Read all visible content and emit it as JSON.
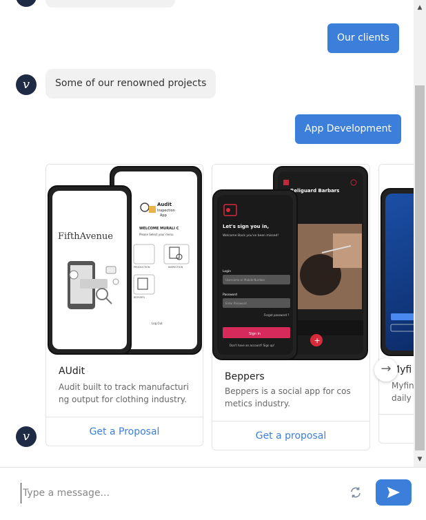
{
  "messages": {
    "our_clients": "Our clients",
    "renowned": "Some of our renowned projects",
    "app_development": "App Development"
  },
  "avatar_letter": "v",
  "cards": [
    {
      "title": "AUdit",
      "desc": "Audit built to track manufacturing output for clothing industry.",
      "button": "Get a Proposal",
      "mock": {
        "brand": "FifthAvenue",
        "app_title": "Audit Inspection App",
        "welcome": "WELCOME MURALI C",
        "select": "Please Select your menu",
        "items": [
          "PRODUCTION",
          "INSPECTION",
          "REPORTS"
        ],
        "logout": "Log Out"
      }
    },
    {
      "title": "Beppers",
      "desc": "Beppers is a social app for cosmetics industry.",
      "button": "Get a proposal",
      "mock": {
        "signin_title": "Let's sign you in,",
        "welcome": "Welcome Back you've been missed!",
        "login_label": "Login",
        "login_ph": "Username or Mobile Number",
        "password_label": "Password",
        "password_ph": "Enter Password",
        "forgot": "Forgot password ?",
        "signin_btn": "Sign in",
        "signup": "Don't have an account? Sign up!",
        "shop": "Religuard Barbars"
      }
    },
    {
      "title": "Myfi",
      "desc": "Myfin daily"
    }
  ],
  "composer": {
    "placeholder": "Type a message..."
  },
  "colors": {
    "accent": "#3b7fdb",
    "avatar_bg": "#1f2a44",
    "bubble_in": "#f1f1f1"
  }
}
